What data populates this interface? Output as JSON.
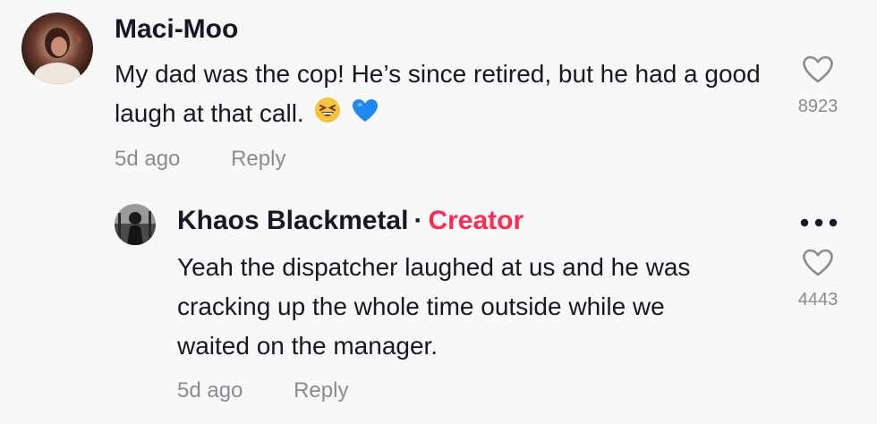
{
  "comments": [
    {
      "author": "Maci-Moo",
      "text": "My dad was the cop! He’s since retired, but he had a good laugh at that call.",
      "emojis": [
        "grinning-squinting-face",
        "blue-heart"
      ],
      "age": "5d ago",
      "reply_label": "Reply",
      "likes": "8923"
    },
    {
      "author": "Khaos Blackmetal",
      "separator": "·",
      "badge": "Creator",
      "text_line1": "Yeah the dispatcher laughed at us and he was",
      "text_line2": "cracking up the whole time outside while we",
      "text_line3": "waited on the manager.",
      "age": "5d ago",
      "reply_label": "Reply",
      "likes": "4443",
      "more_icon": "more-horizontal-icon"
    }
  ],
  "colors": {
    "background": "#f8f8f8",
    "text": "#161823",
    "muted": "#8a8b91",
    "creator": "#fe2c55"
  }
}
